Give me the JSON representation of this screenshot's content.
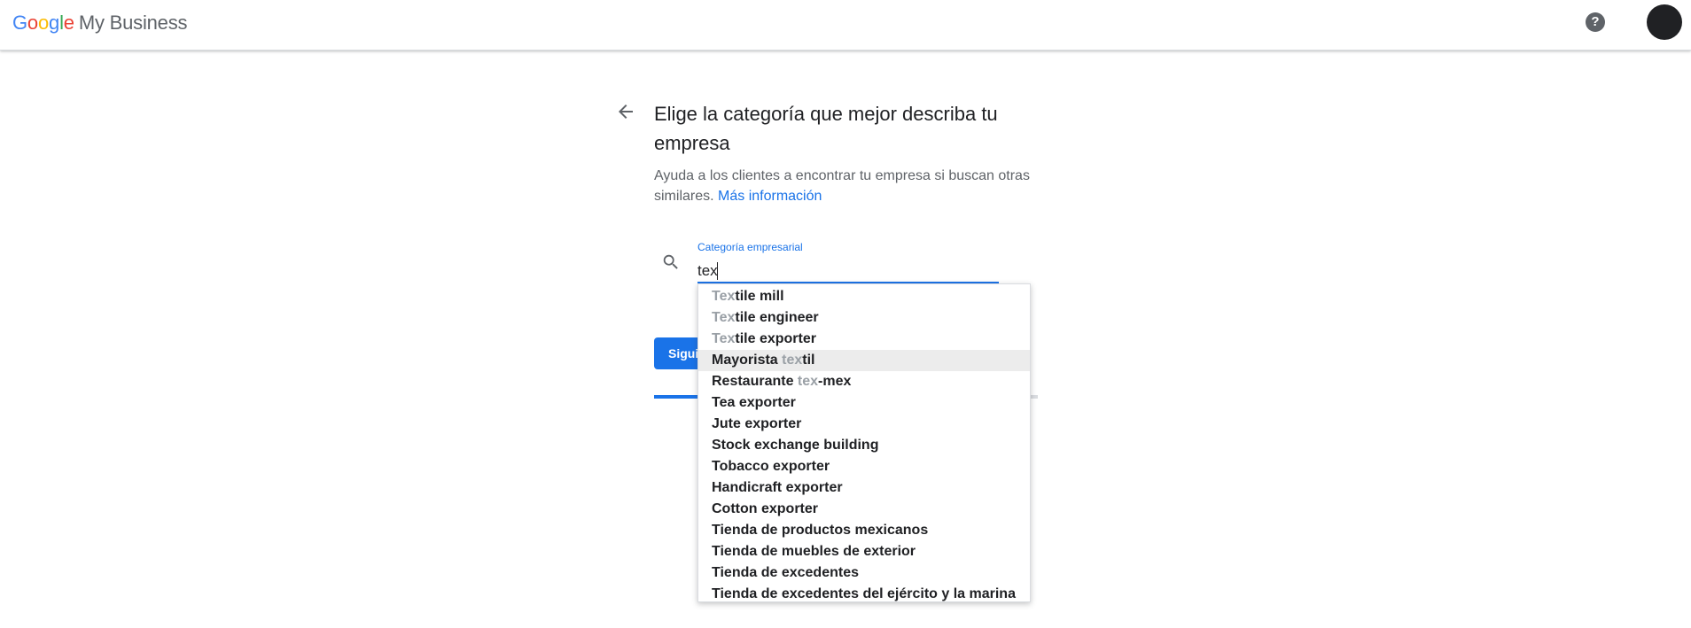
{
  "header": {
    "logo_letters": [
      {
        "char": "G",
        "color": "#4285f4"
      },
      {
        "char": "o",
        "color": "#ea4335"
      },
      {
        "char": "o",
        "color": "#fbbc05"
      },
      {
        "char": "g",
        "color": "#4285f4"
      },
      {
        "char": "l",
        "color": "#34a853"
      },
      {
        "char": "e",
        "color": "#ea4335"
      }
    ],
    "product_name": "My Business",
    "help_icon": "help-circle-icon",
    "help_label": "?"
  },
  "main": {
    "title": "Elige la categoría que mejor describa tu empresa",
    "description": "Ayuda a los clientes a encontrar tu empresa si buscan otras similares.",
    "learn_more_link": "Más información",
    "back_icon": "arrow-back-icon"
  },
  "field": {
    "label": "Categoría empresarial",
    "value": "tex",
    "search_icon": "search-icon"
  },
  "next_button": {
    "label": "Siguiente"
  },
  "progress": {
    "fraction": 0.48
  },
  "suggestions": [
    {
      "before": "",
      "match": "Tex",
      "after": "tile mill",
      "highlighted": false
    },
    {
      "before": "",
      "match": "Tex",
      "after": "tile engineer",
      "highlighted": false
    },
    {
      "before": "",
      "match": "Tex",
      "after": "tile exporter",
      "highlighted": false
    },
    {
      "before": "Mayorista ",
      "match": "tex",
      "after": "til",
      "highlighted": true
    },
    {
      "before": "Restaurante ",
      "match": "tex",
      "after": "-mex",
      "highlighted": false
    },
    {
      "before": "Tea exporter",
      "match": "",
      "after": "",
      "highlighted": false
    },
    {
      "before": "Jute exporter",
      "match": "",
      "after": "",
      "highlighted": false
    },
    {
      "before": "Stock exchange building",
      "match": "",
      "after": "",
      "highlighted": false
    },
    {
      "before": "Tobacco exporter",
      "match": "",
      "after": "",
      "highlighted": false
    },
    {
      "before": "Handicraft exporter",
      "match": "",
      "after": "",
      "highlighted": false
    },
    {
      "before": "Cotton exporter",
      "match": "",
      "after": "",
      "highlighted": false
    },
    {
      "before": "Tienda de productos mexicanos",
      "match": "",
      "after": "",
      "highlighted": false
    },
    {
      "before": "Tienda de muebles de exterior",
      "match": "",
      "after": "",
      "highlighted": false
    },
    {
      "before": "Tienda de excedentes",
      "match": "",
      "after": "",
      "highlighted": false
    },
    {
      "before": "Tienda de excedentes del ejército y la marina",
      "match": "",
      "after": "",
      "highlighted": false
    }
  ]
}
